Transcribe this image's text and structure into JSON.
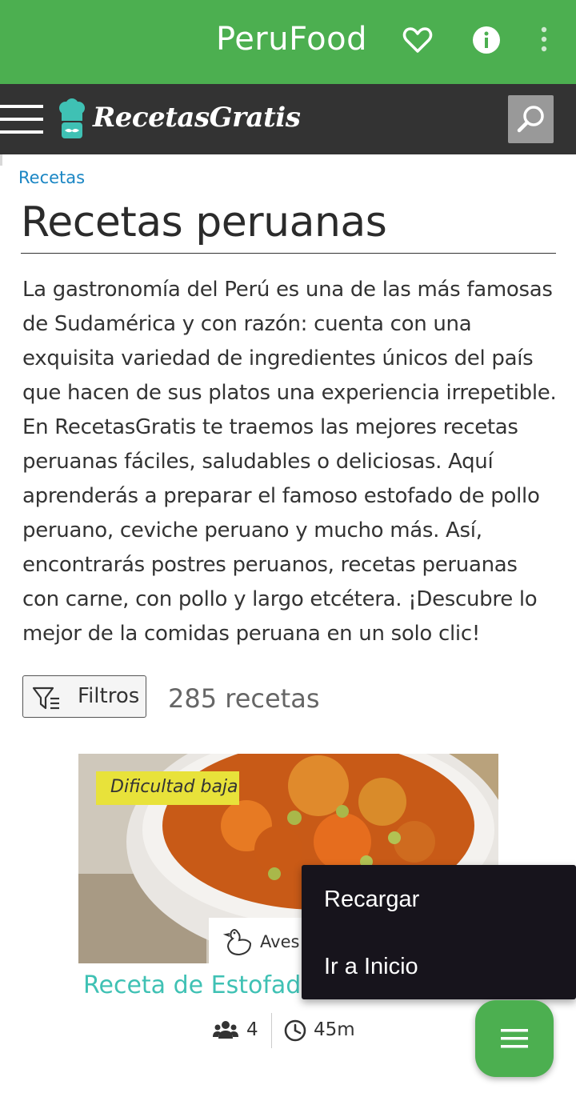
{
  "app_bar": {
    "title": "PeruFood",
    "icons": [
      "heart-icon",
      "info-icon",
      "more-vert-icon"
    ],
    "color": "#4caf50"
  },
  "site_header": {
    "logo_text": "RecetasGratis",
    "icons": [
      "hamburger-menu-icon",
      "chef-hat-icon",
      "search-icon"
    ],
    "color": "#333333"
  },
  "breadcrumb": "Recetas",
  "page_title": "Recetas peruanas",
  "intro": "La gastronomía del Perú es una de las más famosas de Sudamérica y con razón: cuenta con una exquisita variedad de ingredientes únicos del país que hacen de sus platos una experiencia irrepetible. En RecetasGratis te traemos las mejores recetas peruanas fáciles, saludables o deliciosas. Aquí aprenderás a preparar el famoso estofado de pollo peruano, ceviche peruano y mucho más. Así, encontrarás postres peruanos, recetas peruanas con carne, con pollo y largo etcétera. ¡Descubre lo mejor de la comidas peruana en un solo clic!",
  "filters": {
    "label": "Filtros",
    "count": "285 recetas"
  },
  "recipe_card": {
    "difficulty": "Dificultad baja",
    "category": "Aves",
    "title": "Receta de Estofado",
    "servings": "4",
    "time": "45m",
    "title_color": "#3fc1b4",
    "badge_color": "#e8e23a"
  },
  "context_menu": {
    "items": [
      "Recargar",
      "Ir a Inicio"
    ]
  },
  "fab": {
    "icon": "menu-icon",
    "color": "#4caf50"
  }
}
